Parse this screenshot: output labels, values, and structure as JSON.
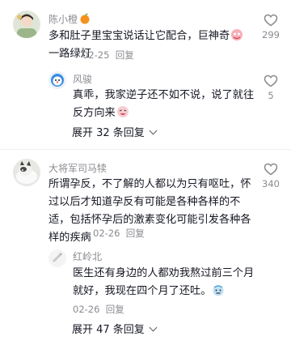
{
  "comments": [
    {
      "username": "陈小橙",
      "text_line1": "多和肚子里宝宝说话让它配合，巨神奇",
      "text_line2": "一路绿灯",
      "date": "02-25",
      "reply_label": "回复",
      "likes": "299",
      "reply": {
        "username": "风骏",
        "text_line1": "真乖，我家逆子还不如不说，说了就往",
        "text_line2": "反方向来",
        "likes": "5"
      },
      "expand_label": "展开 32 条回复"
    },
    {
      "username": "大将军司马犊",
      "text_line1": "所谓孕反，不了解的人都以为只有呕吐，怀",
      "text_line2": "过以后才知道孕反有可能是各种各样的不",
      "text_line3": "适，包括怀孕后的激素变化可能引发各种各",
      "text_line4": "样的疾病",
      "date": "02-26",
      "reply_label": "回复",
      "likes": "340",
      "reply": {
        "username": "红岭北",
        "text_line1": "医生还有身边的人都劝我熬过前三个月",
        "text_line2": "就好，我现在四个月了还吐。",
        "date": "02-26",
        "reply_label": "回复"
      },
      "expand_label": "展开 47 条回复"
    }
  ],
  "icons": {
    "like": "heart-outline-icon",
    "orange": "orange-emoji-icon",
    "expand": "chevron-down-icon"
  },
  "colors": {
    "text": "#161823",
    "muted": "#8a8b91"
  }
}
